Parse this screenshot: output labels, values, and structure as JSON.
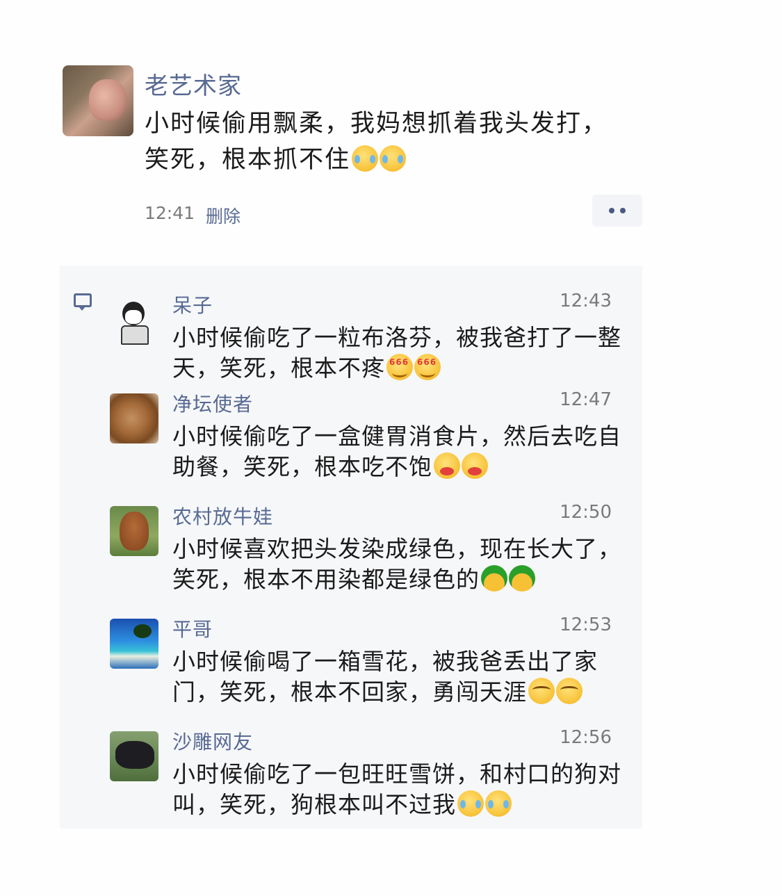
{
  "post": {
    "author": "老艺术家",
    "text": "小时候偷用飘柔，我妈想抓着我头发打，笑死，根本抓不住",
    "time": "12:41",
    "delete_label": "删除",
    "emojis": [
      "cry-laugh-emoji",
      "cry-laugh-emoji"
    ]
  },
  "comments": [
    {
      "name": "呆子",
      "time": "12:43",
      "text": "小时候偷吃了一粒布洛芬，被我爸打了一整天，笑死，根本不疼"
    },
    {
      "name": "净坛使者",
      "time": "12:47",
      "text": "小时候偷吃了一盒健胃消食片，然后去吃自助餐，笑死，根本吃不饱"
    },
    {
      "name": "农村放牛娃",
      "time": "12:50",
      "text": "小时候喜欢把头发染成绿色，现在长大了，笑死，根本不用染都是绿色的"
    },
    {
      "name": "平哥",
      "time": "12:53",
      "text": "小时候偷喝了一箱雪花，被我爸丢出了家门，笑死，根本不回家，勇闯天涯"
    },
    {
      "name": "沙雕网友",
      "time": "12:56",
      "text": "小时候偷吃了一包旺旺雪饼，和村口的狗对叫，笑死，狗根本叫不过我"
    }
  ],
  "colors": {
    "name_blue": "#586a93",
    "text": "#1b1b1b",
    "comments_bg": "#f6f7f9"
  },
  "icons": [
    "comment-icon",
    "more-icon"
  ]
}
